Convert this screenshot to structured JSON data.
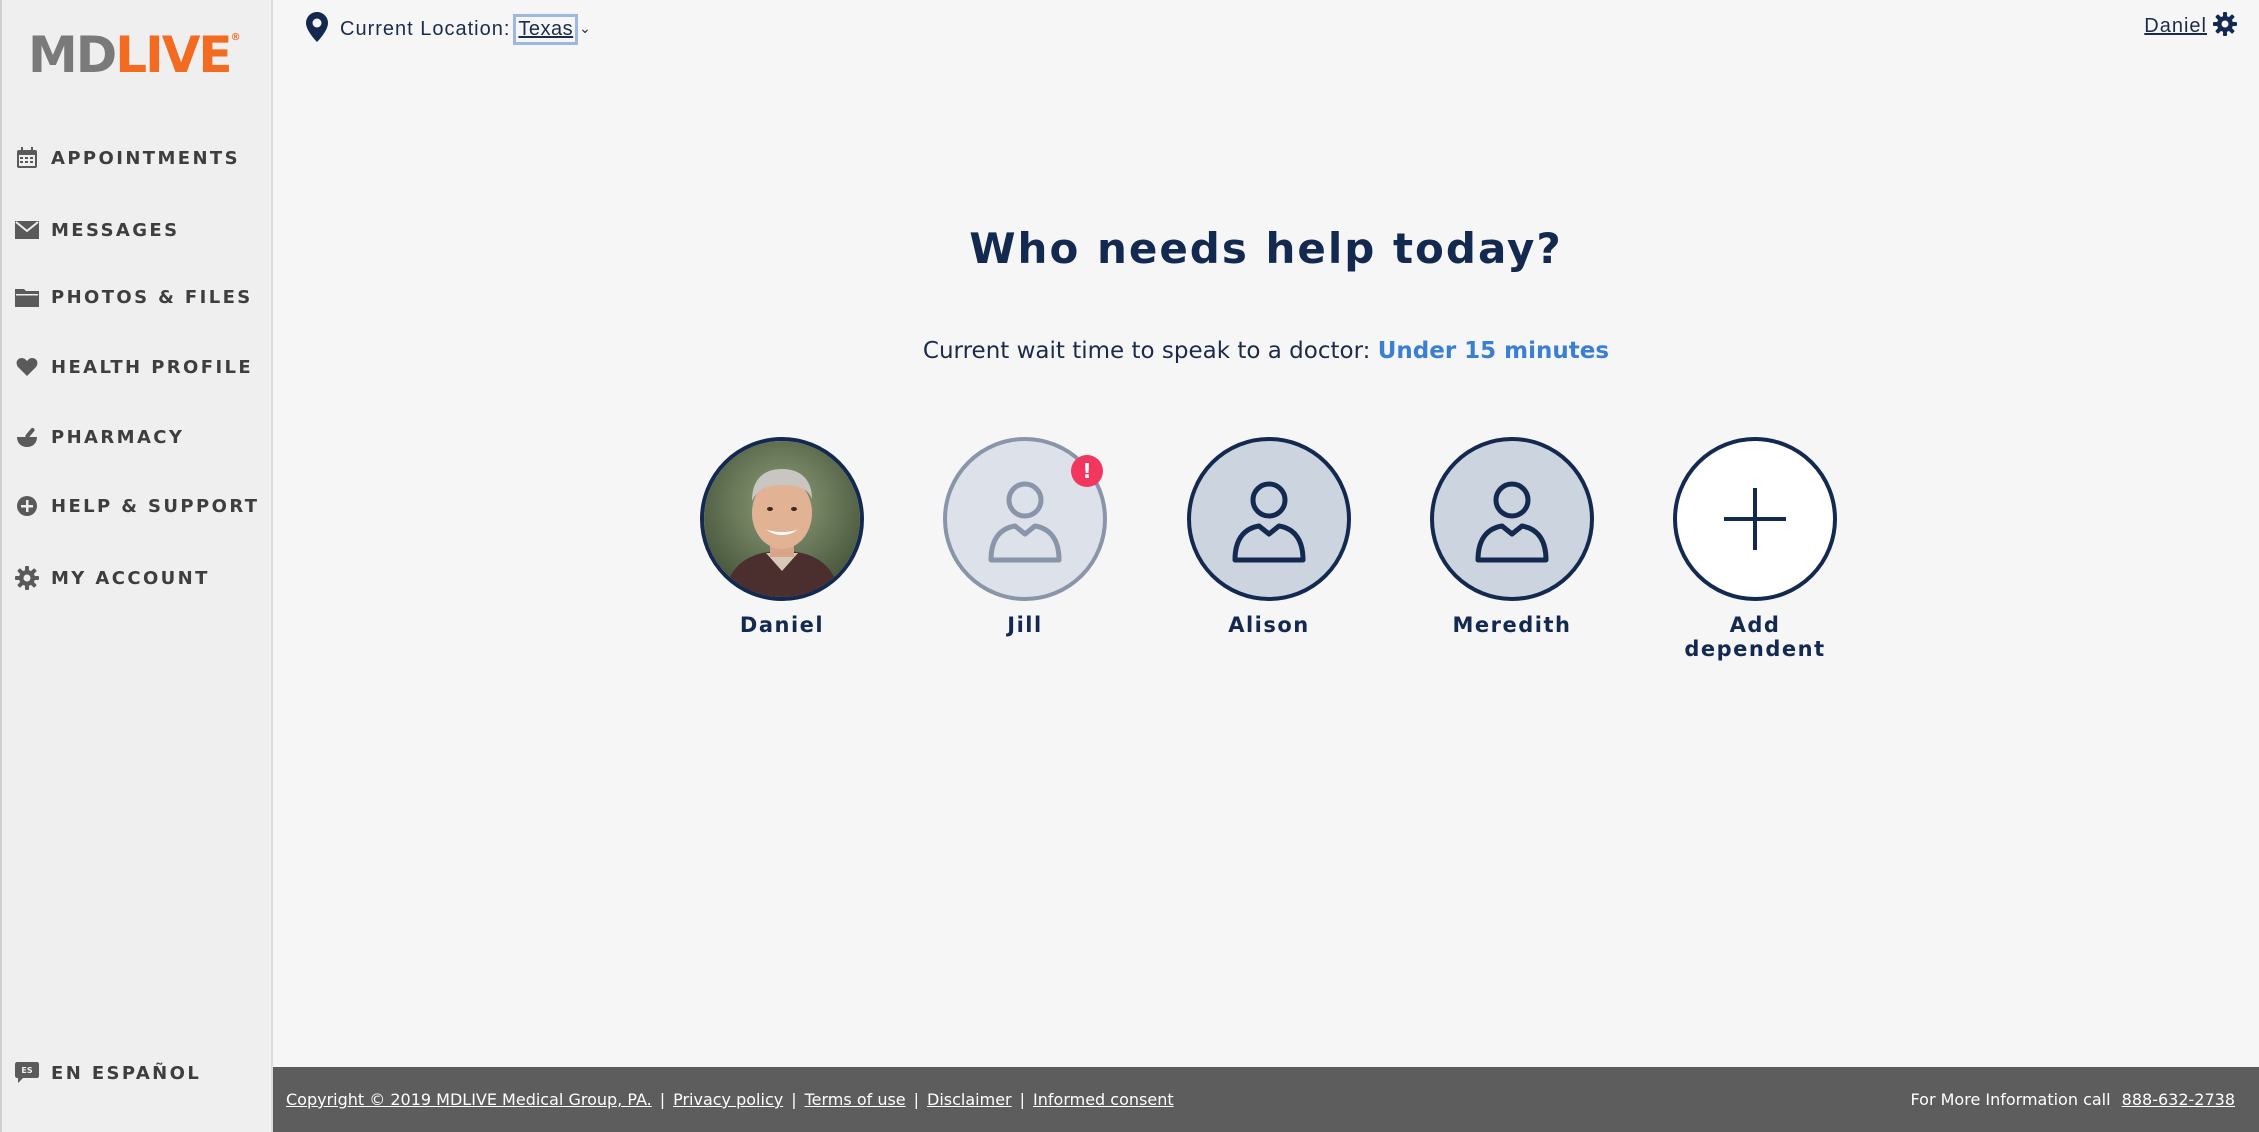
{
  "brand": {
    "logo_md": "MD",
    "logo_live": "LIVE",
    "logo_reg": "®",
    "accent": "#f26b21",
    "navy": "#14294f"
  },
  "sidebar": {
    "items": [
      {
        "label": "APPOINTMENTS",
        "icon": "calendar-icon"
      },
      {
        "label": "MESSAGES",
        "icon": "envelope-icon"
      },
      {
        "label": "PHOTOS & FILES",
        "icon": "folder-icon"
      },
      {
        "label": "HEALTH PROFILE",
        "icon": "heart-icon"
      },
      {
        "label": "PHARMACY",
        "icon": "mortar-pestle-icon"
      },
      {
        "label": "HELP & SUPPORT",
        "icon": "plus-circle-icon"
      },
      {
        "label": "MY ACCOUNT",
        "icon": "gear-icon"
      }
    ],
    "language": {
      "label": "EN ESPAÑOL",
      "icon_text": "ES"
    }
  },
  "topbar": {
    "location_label": "Current Location:",
    "location_value": "Texas",
    "user_name": "Daniel"
  },
  "main": {
    "headline": "Who needs help today?",
    "wait_label": "Current wait time to speak to a doctor:",
    "wait_time": "Under 15 minutes",
    "profiles": [
      {
        "name": "Daniel",
        "type": "photo"
      },
      {
        "name": "Jill",
        "type": "placeholder",
        "alert": "!"
      },
      {
        "name": "Alison",
        "type": "placeholder"
      },
      {
        "name": "Meredith",
        "type": "placeholder"
      },
      {
        "name": "Add dependent",
        "type": "add"
      }
    ]
  },
  "footer": {
    "copyright": "Copyright © 2019 MDLIVE Medical Group, PA.",
    "privacy": "Privacy policy",
    "terms": "Terms of use",
    "disclaimer": "Disclaimer",
    "consent": "Informed consent",
    "info_label": "For More Information call",
    "phone": "888-632-2738"
  }
}
